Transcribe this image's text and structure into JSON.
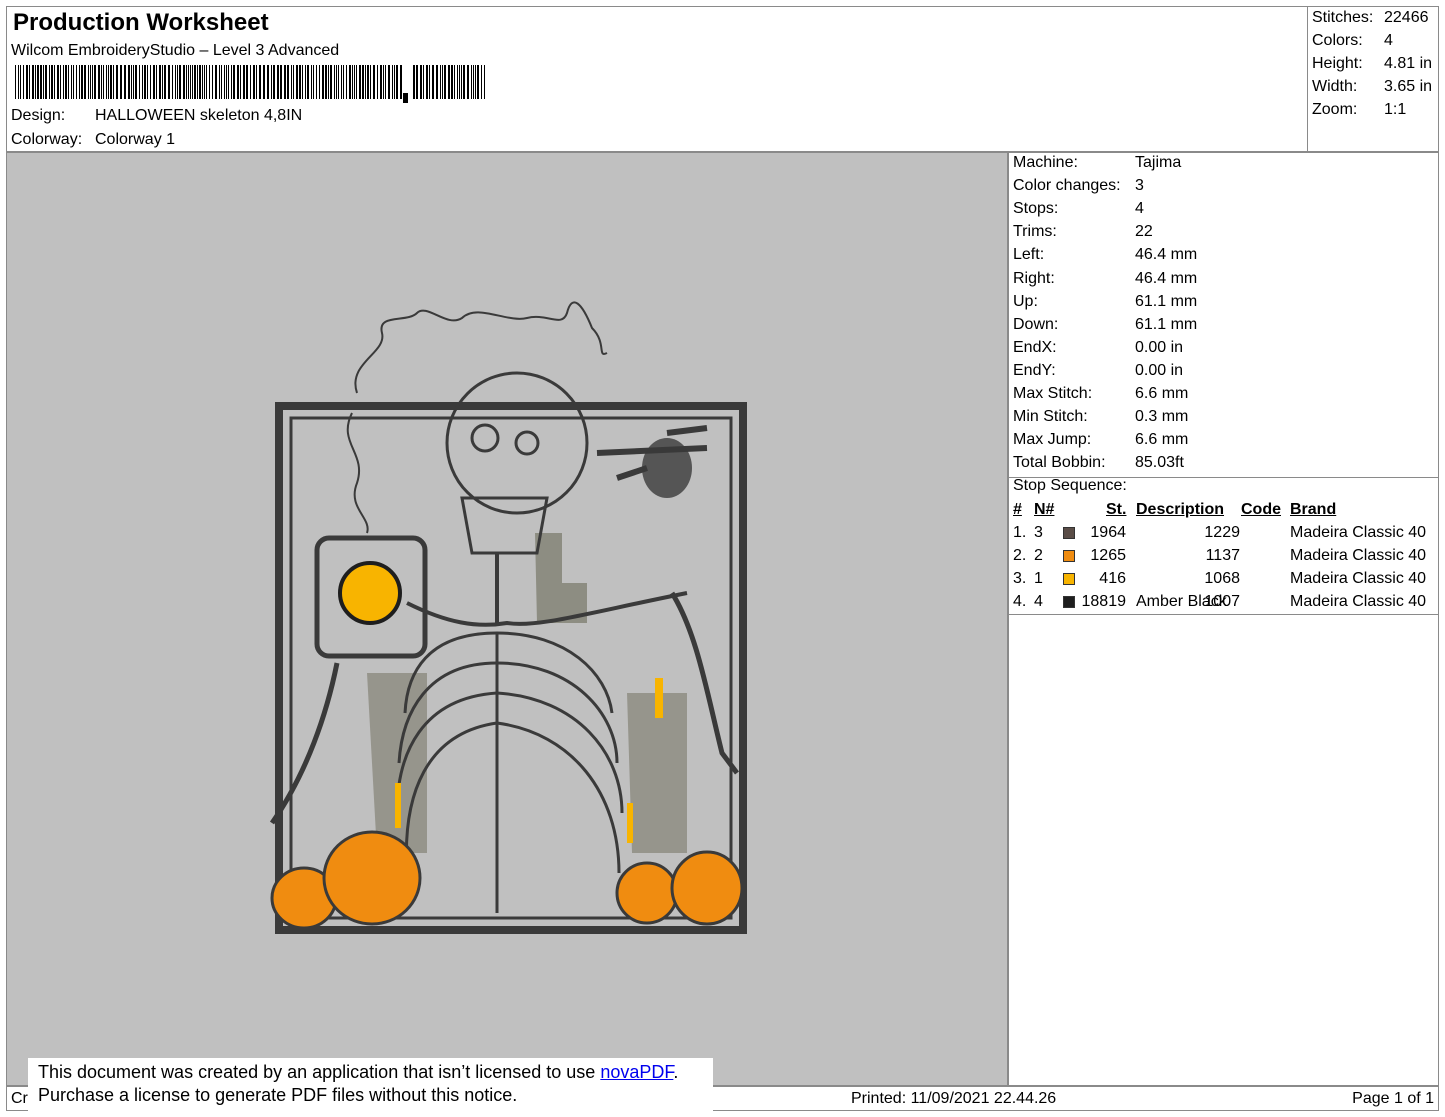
{
  "header": {
    "title": "Production Worksheet",
    "software": "Wilcom EmbroideryStudio – Level 3 Advanced",
    "design_label": "Design:",
    "design_value": "HALLOWEEN skeleton 4,8IN",
    "colorway_label": "Colorway:",
    "colorway_value": "Colorway 1"
  },
  "stats": {
    "stitches_label": "Stitches:",
    "stitches": "22466",
    "colors_label": "Colors:",
    "colors": "4",
    "height_label": "Height:",
    "height": "4.81 in",
    "width_label": "Width:",
    "width": "3.65 in",
    "zoom_label": "Zoom:",
    "zoom": "1:1"
  },
  "machine_info": [
    {
      "label": "Machine:",
      "value": "Tajima"
    },
    {
      "label": "Color changes:",
      "value": "3"
    },
    {
      "label": "Stops:",
      "value": "4"
    },
    {
      "label": "Trims:",
      "value": "22"
    },
    {
      "label": "Left:",
      "value": "46.4 mm"
    },
    {
      "label": "Right:",
      "value": "46.4 mm"
    },
    {
      "label": "Up:",
      "value": "61.1 mm"
    },
    {
      "label": "Down:",
      "value": "61.1 mm"
    },
    {
      "label": "EndX:",
      "value": "0.00 in"
    },
    {
      "label": "EndY:",
      "value": "0.00 in"
    },
    {
      "label": "Max Stitch:",
      "value": "6.6 mm"
    },
    {
      "label": "Min Stitch:",
      "value": "0.3 mm"
    },
    {
      "label": "Max Jump:",
      "value": "6.6 mm"
    },
    {
      "label": "Total Bobbin:",
      "value": "85.03ft"
    }
  ],
  "stop_sequence": {
    "title": "Stop Sequence:",
    "headers": {
      "num": "#",
      "needle": "N#",
      "stitches": "St.",
      "description": "Description",
      "code": "Code",
      "brand": "Brand"
    },
    "rows": [
      {
        "num": "1.",
        "needle": "3",
        "color": "#5a4d47",
        "stitches": "1964",
        "description": "",
        "code": "1229",
        "brand": "Madeira Classic 40"
      },
      {
        "num": "2.",
        "needle": "2",
        "color": "#f08c10",
        "stitches": "1265",
        "description": "",
        "code": "1137",
        "brand": "Madeira Classic 40"
      },
      {
        "num": "3.",
        "needle": "1",
        "color": "#f8b400",
        "stitches": "416",
        "description": "",
        "code": "1068",
        "brand": "Madeira Classic 40"
      },
      {
        "num": "4.",
        "needle": "4",
        "color": "#1e1e1e",
        "stitches": "18819",
        "description": "Amber Black",
        "code": "1007",
        "brand": "Madeira Classic 40"
      }
    ]
  },
  "footer": {
    "left_text": "Cr",
    "printed": "Printed: 11/09/2021 22.44.26",
    "page": "Page 1 of 1"
  },
  "notice": {
    "line1_before": "This document was created by an application that isn’t licensed to use ",
    "link": "novaPDF",
    "line1_after": ".",
    "line2": "Purchase a license to generate PDF files without this notice."
  },
  "colors": {
    "canvas_bg": "#c0c0c0",
    "thread_dark": "#1e1e1e",
    "thread_brown": "#5a4d47",
    "thread_orange": "#f08c10",
    "thread_yellow": "#f8b400"
  }
}
